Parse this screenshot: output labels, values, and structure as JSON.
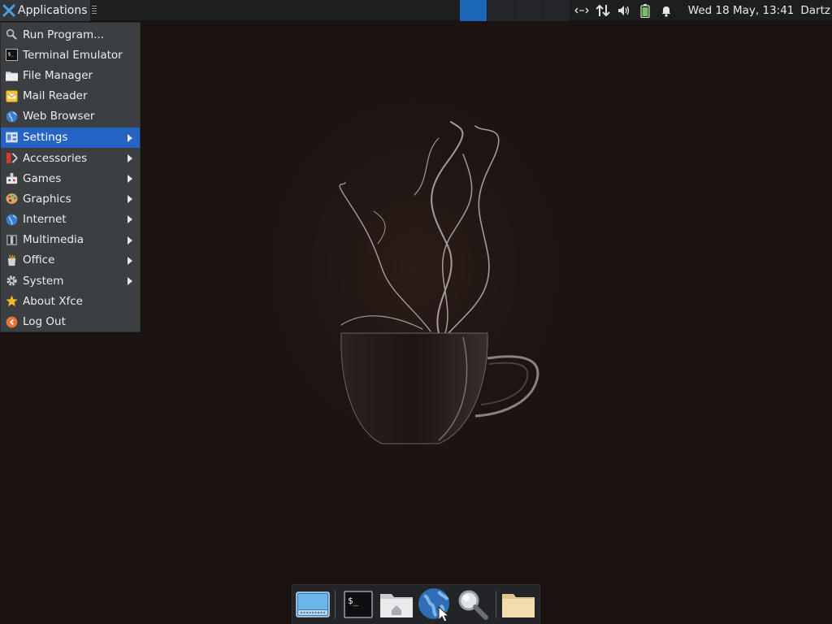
{
  "top_panel": {
    "applications_label": "Applications",
    "clock": "Wed 18 May, 13:41",
    "user": "Dartz",
    "workspaces": [
      {
        "active": true
      },
      {
        "active": false
      },
      {
        "active": false
      },
      {
        "active": false
      }
    ],
    "tray_icons": [
      "network-icon",
      "data-transfer-icon",
      "volume-icon",
      "battery-icon",
      "notification-bell-icon"
    ]
  },
  "menu": {
    "items": [
      {
        "label": "Run Program...",
        "icon": "magnifier-icon",
        "submenu": false
      },
      {
        "label": "Terminal Emulator",
        "icon": "terminal-icon",
        "submenu": false
      },
      {
        "label": "File Manager",
        "icon": "folder-icon",
        "submenu": false
      },
      {
        "label": "Mail Reader",
        "icon": "mail-icon",
        "submenu": false
      },
      {
        "label": "Web Browser",
        "icon": "globe-icon",
        "submenu": false
      },
      {
        "label": "Settings",
        "icon": "settings-icon",
        "submenu": true,
        "active": true
      },
      {
        "label": "Accessories",
        "icon": "accessories-icon",
        "submenu": true
      },
      {
        "label": "Games",
        "icon": "games-icon",
        "submenu": true
      },
      {
        "label": "Graphics",
        "icon": "palette-icon",
        "submenu": true
      },
      {
        "label": "Internet",
        "icon": "globe-icon",
        "submenu": true
      },
      {
        "label": "Multimedia",
        "icon": "multimedia-icon",
        "submenu": true
      },
      {
        "label": "Office",
        "icon": "office-icon",
        "submenu": true
      },
      {
        "label": "System",
        "icon": "gear-icon",
        "submenu": true
      },
      {
        "label": "About Xfce",
        "icon": "star-icon",
        "submenu": false
      },
      {
        "label": "Log Out",
        "icon": "logout-icon",
        "submenu": false
      }
    ]
  },
  "dock": {
    "items": [
      "show-desktop-icon",
      "terminal-icon",
      "home-folder-icon",
      "web-browser-icon",
      "app-finder-icon",
      "folder-icon"
    ]
  },
  "colors": {
    "panel_bg": "#1d1e20",
    "menu_bg": "#3c3f42",
    "menu_active": "#2563c4",
    "workspace_active": "#1c66b8",
    "desktop_bg": "#1b1212"
  }
}
